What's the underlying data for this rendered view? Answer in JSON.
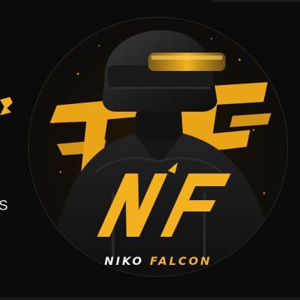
{
  "profile": {
    "brand_first": "NIKO",
    "brand_last": "FALCON",
    "monogram": "NF",
    "left_fragment_text": "S"
  },
  "colors": {
    "background": "#0b0b0b",
    "accent": "#f3b21d",
    "text": "#f2f2f2"
  },
  "icons": {
    "avatar": "helmeted-soldier-logo",
    "left_fragment": "partial-logo-icon"
  }
}
